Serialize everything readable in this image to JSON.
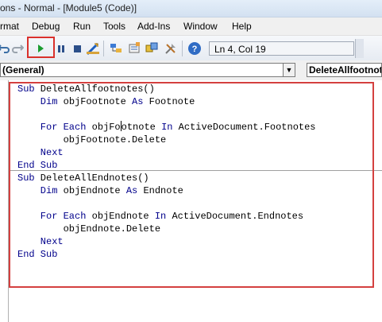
{
  "window": {
    "title": "ons - Normal - [Module5 (Code)]"
  },
  "menu": [
    {
      "key": "format",
      "label": "rmat"
    },
    {
      "key": "debug",
      "label": "Debug"
    },
    {
      "key": "run",
      "label": "Run"
    },
    {
      "key": "tools",
      "label": "Tools"
    },
    {
      "key": "addins",
      "label": "Add-Ins"
    },
    {
      "key": "window",
      "label": "Window"
    },
    {
      "key": "help",
      "label": "Help"
    }
  ],
  "toolbar": {
    "status": "Ln 4, Col 19",
    "icons": [
      "undo-icon",
      "redo-icon",
      "run-icon",
      "break-icon",
      "reset-icon",
      "design-mode-icon",
      "project-explorer-icon",
      "properties-icon",
      "object-browser-icon",
      "toolbox-icon",
      "help-icon"
    ],
    "colors": {
      "run": "#1a9c2f",
      "highlight": "#d9302c"
    }
  },
  "object_combo": {
    "value": "(General)"
  },
  "procedure_combo": {
    "value": "DeleteAllfootnotes"
  },
  "code": {
    "proc1": {
      "l1": [
        "Sub",
        " DeleteAllfootnotes()"
      ],
      "l2": [
        "    Dim",
        " objFootnote ",
        "As",
        " Footnote"
      ],
      "l4": [
        "    For Each",
        " objFo",
        "otnote ",
        "In",
        " ActiveDocument.Footnotes"
      ],
      "l5": "        objFootnote.Delete",
      "l6": "    Next",
      "l7": "End Sub"
    },
    "proc2": {
      "l1": [
        "Sub",
        " DeleteAllEndnotes()"
      ],
      "l2": [
        "    Dim",
        " objEndnote ",
        "As",
        " Endnote"
      ],
      "l4": [
        "    For Each",
        " objEndnote ",
        "In",
        " ActiveDocument.Endnotes"
      ],
      "l5": "        objEndnote.Delete",
      "l6": "    Next",
      "l7": "End Sub"
    }
  }
}
